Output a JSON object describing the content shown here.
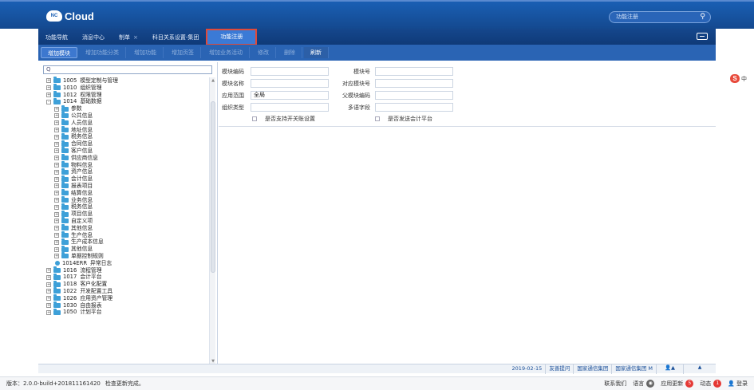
{
  "app": {
    "logo_badge": "NC",
    "logo_text": "Cloud"
  },
  "header": {
    "search_placeholder": "功能注册",
    "search_icon": "magnifier-icon"
  },
  "nav": {
    "tabs": [
      {
        "label": "功能导航",
        "closable": false
      },
      {
        "label": "消息中心",
        "closable": false
      },
      {
        "label": "制单",
        "closable": true
      },
      {
        "label": "科目关系设置-集团",
        "closable": false
      },
      {
        "label": "功能注册",
        "closable": false,
        "active": true
      }
    ],
    "close_glyph": "×"
  },
  "toolbar": {
    "buttons": [
      {
        "label": "增加模块",
        "enabled": true
      },
      {
        "label": "增加功能分类",
        "enabled": false
      },
      {
        "label": "增加功能",
        "enabled": false
      },
      {
        "label": "增加页签",
        "enabled": false
      },
      {
        "label": "增加业务活动",
        "enabled": false
      },
      {
        "label": "修改",
        "enabled": false
      },
      {
        "label": "删除",
        "enabled": false
      },
      {
        "label": "刷新",
        "enabled": true
      }
    ]
  },
  "tree": {
    "search_value": "Q",
    "items": [
      {
        "level": 0,
        "expander": "+",
        "code": "1005",
        "name": "模型定制与管理"
      },
      {
        "level": 0,
        "expander": "+",
        "code": "1010",
        "name": "组织管理"
      },
      {
        "level": 0,
        "expander": "+",
        "code": "1012",
        "name": "权限管理"
      },
      {
        "level": 0,
        "expander": "-",
        "code": "1014",
        "name": "基础数据"
      },
      {
        "level": 1,
        "expander": "+",
        "code": "",
        "name": "参数"
      },
      {
        "level": 1,
        "expander": "+",
        "code": "",
        "name": "公共信息"
      },
      {
        "level": 1,
        "expander": "+",
        "code": "",
        "name": "人员信息"
      },
      {
        "level": 1,
        "expander": "+",
        "code": "",
        "name": "地址信息"
      },
      {
        "level": 1,
        "expander": "+",
        "code": "",
        "name": "税务信息"
      },
      {
        "level": 1,
        "expander": "+",
        "code": "",
        "name": "合同信息"
      },
      {
        "level": 1,
        "expander": "+",
        "code": "",
        "name": "客户信息"
      },
      {
        "level": 1,
        "expander": "+",
        "code": "",
        "name": "供应商信息"
      },
      {
        "level": 1,
        "expander": "+",
        "code": "",
        "name": "物料信息"
      },
      {
        "level": 1,
        "expander": "+",
        "code": "",
        "name": "资产信息"
      },
      {
        "level": 1,
        "expander": "+",
        "code": "",
        "name": "会计信息"
      },
      {
        "level": 1,
        "expander": "+",
        "code": "",
        "name": "报表项目"
      },
      {
        "level": 1,
        "expander": "+",
        "code": "",
        "name": "结算信息"
      },
      {
        "level": 1,
        "expander": "+",
        "code": "",
        "name": "业务信息"
      },
      {
        "level": 1,
        "expander": "+",
        "code": "",
        "name": "税务信息"
      },
      {
        "level": 1,
        "expander": "+",
        "code": "",
        "name": "项目信息"
      },
      {
        "level": 1,
        "expander": "+",
        "code": "",
        "name": "自定义项"
      },
      {
        "level": 1,
        "expander": "+",
        "code": "",
        "name": "其他信息"
      },
      {
        "level": 1,
        "expander": "+",
        "code": "",
        "name": "生产信息"
      },
      {
        "level": 1,
        "expander": "+",
        "code": "",
        "name": "生产成本信息"
      },
      {
        "level": 1,
        "expander": "+",
        "code": "",
        "name": "其他信息"
      },
      {
        "level": 1,
        "expander": "+",
        "code": "",
        "name": "单据控制规则"
      },
      {
        "level": 1,
        "expander": "",
        "code": "1014ERR",
        "name": "异常日志",
        "leaf": true
      },
      {
        "level": 0,
        "expander": "+",
        "code": "1016",
        "name": "流程管理"
      },
      {
        "level": 0,
        "expander": "+",
        "code": "1017",
        "name": "会计平台"
      },
      {
        "level": 0,
        "expander": "+",
        "code": "1018",
        "name": "客户化配置"
      },
      {
        "level": 0,
        "expander": "+",
        "code": "1022",
        "name": "开发配置工具"
      },
      {
        "level": 0,
        "expander": "+",
        "code": "1026",
        "name": "应用资产管理"
      },
      {
        "level": 0,
        "expander": "+",
        "code": "1030",
        "name": "自由报表"
      },
      {
        "level": 0,
        "expander": "+",
        "code": "1050",
        "name": "计划平台"
      }
    ]
  },
  "form": {
    "module_code_label": "模块编码",
    "module_code_value": "",
    "module_name_label": "模块名称",
    "module_name_value": "",
    "app_scope_label": "应用范围",
    "app_scope_value": "全局",
    "org_type_label": "组织类型",
    "org_type_value": "",
    "module_no_label": "模块号",
    "module_no_value": "",
    "mapping_no_label": "对应模块号",
    "mapping_no_value": "",
    "parent_code_label": "父模块编码",
    "parent_code_value": "",
    "multilang_label": "多语字段",
    "multilang_value": "",
    "check_switch_label": "是否支持开关账设置",
    "check_send_label": "是否发送会计平台"
  },
  "bottom_bar": {
    "date": "2019-02-15",
    "links": [
      "友善提问",
      "国家通信集团",
      "国家通信集团 M"
    ],
    "user_glyph": "▲",
    "expand_glyph": "▲"
  },
  "status": {
    "version": "版本：2.0.0-build+201811161420",
    "message": "检查更新完成。",
    "contact": "联系我们",
    "language": "语言",
    "app_update": "应用更新",
    "app_update_count": "5",
    "activity": "动态",
    "activity_count": "1",
    "login": "登录"
  },
  "ime": {
    "logo": "S",
    "label": "中"
  },
  "colors": {
    "header_blue": "#1a5fb4",
    "nav_blue": "#15478d",
    "active_tab": "#3b7ad6",
    "active_border": "#e04a3a",
    "folder": "#3ea0d8",
    "badge_red": "#e53935"
  }
}
